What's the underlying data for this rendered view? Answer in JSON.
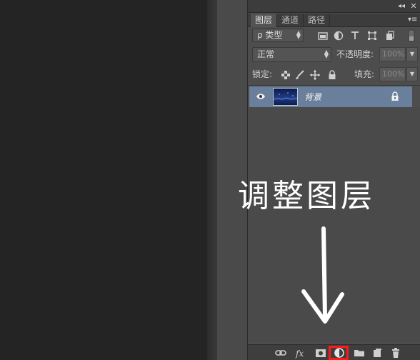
{
  "panel": {
    "collapse_icon": "double-chevron-left-icon",
    "close_icon": "close-icon",
    "menu_icon": "panel-menu-icon",
    "tabs": [
      {
        "label": "图层",
        "active": true
      },
      {
        "label": "通道",
        "active": false
      },
      {
        "label": "路径",
        "active": false
      }
    ],
    "filter": {
      "kind_label": "ρ 类型"
    },
    "blend": {
      "mode": "正常",
      "opacity_label": "不透明度:",
      "opacity_value": "100%"
    },
    "lock": {
      "label": "锁定:",
      "fill_label": "填充:",
      "fill_value": "100%"
    },
    "layers": [
      {
        "name": "背景",
        "visible": true,
        "locked": true,
        "selected": true
      }
    ],
    "bottom_icons": [
      "link-layers-icon",
      "fx-icon",
      "add-mask-icon",
      "adjustment-layer-icon",
      "new-group-icon",
      "new-layer-icon",
      "trash-icon"
    ],
    "highlight_color": "#ff1a1a"
  },
  "annotation": {
    "text": "调整图层",
    "arrow": "down-arrow-icon"
  }
}
